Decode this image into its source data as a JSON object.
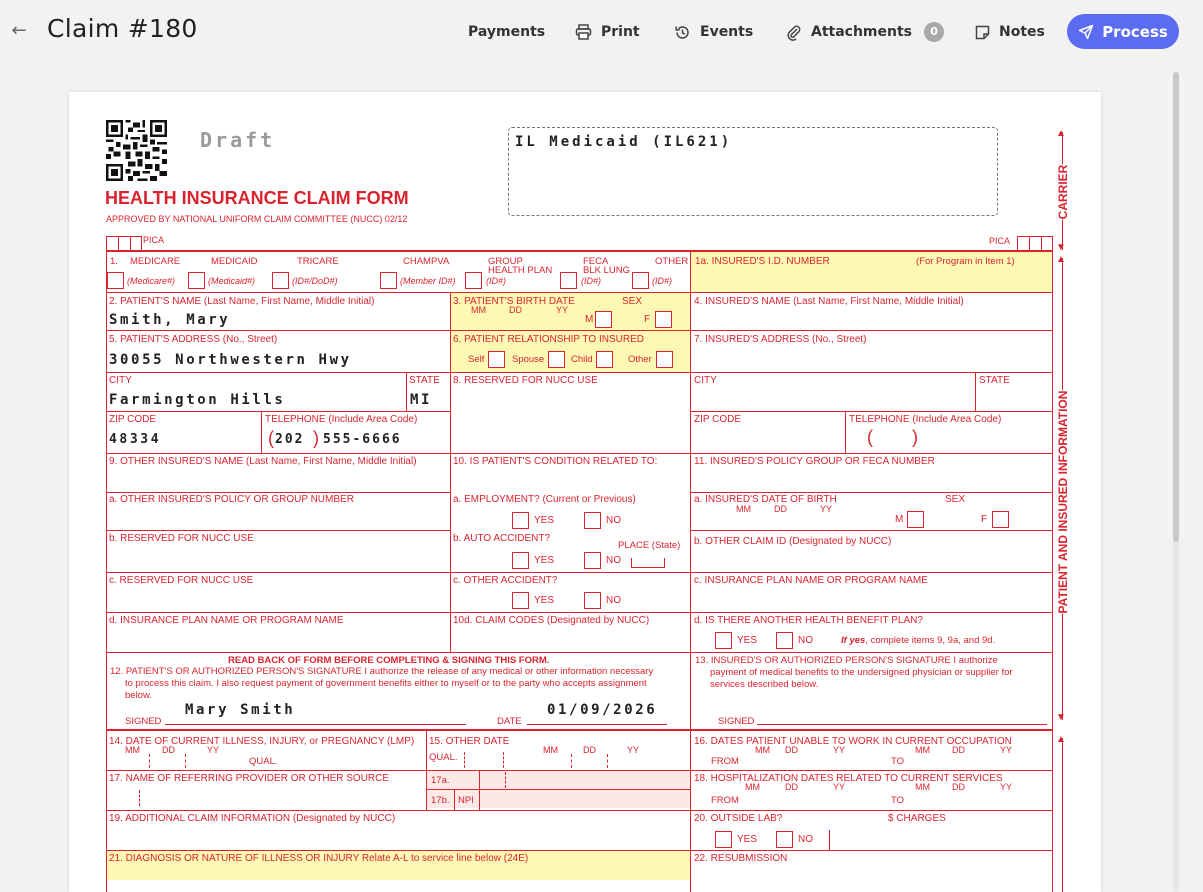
{
  "header": {
    "title": "Claim #180",
    "toolbar": {
      "payments": "Payments",
      "print": "Print",
      "events": "Events",
      "attachments": "Attachments",
      "attachments_count": "0",
      "notes": "Notes",
      "process": "Process"
    },
    "accent": "#5b6cf0"
  },
  "form": {
    "draft": "Draft",
    "payer_box": "IL Medicaid (IL621)",
    "title": "HEALTH INSURANCE CLAIM FORM",
    "approved": "APPROVED BY NATIONAL UNIFORM CLAIM COMMITTEE (NUCC) 02/12",
    "pica": "PICA",
    "carrier": "CARRIER",
    "patient_insured_info": "PATIENT AND INSURED INFORMATION",
    "color": "#d9242f",
    "highlight": "#fdf9b5",
    "f1": {
      "label": "1.",
      "medicare": "MEDICARE",
      "medicare_id": "(Medicare#)",
      "medicaid": "MEDICAID",
      "medicaid_id": "(Medicaid#)",
      "tricare": "TRICARE",
      "tricare_id": "(ID#/DoD#)",
      "champva": "CHAMPVA",
      "champva_id": "(Member ID#)",
      "group": "GROUP",
      "group2": "HEALTH PLAN",
      "group_id": "(ID#)",
      "feca": "FECA",
      "feca2": "BLK LUNG",
      "feca_id": "(ID#)",
      "other": "OTHER",
      "other_id": "(ID#)"
    },
    "f1a": {
      "label": "1a. INSURED'S I.D. NUMBER",
      "note": "(For Program in Item 1)"
    },
    "f2": {
      "label": "2. PATIENT'S NAME (Last Name, First Name, Middle Initial)",
      "value": "Smith, Mary"
    },
    "f3": {
      "label": "3. PATIENT'S BIRTH DATE",
      "sex": "SEX",
      "mm": "MM",
      "dd": "DD",
      "yy": "YY",
      "m": "M",
      "f": "F"
    },
    "f4": {
      "label": "4. INSURED'S NAME (Last Name, First Name, Middle Initial)"
    },
    "f5": {
      "label": "5. PATIENT'S ADDRESS (No., Street)",
      "value": "30055 Northwestern Hwy"
    },
    "f6": {
      "label": "6. PATIENT RELATIONSHIP TO INSURED",
      "self": "Self",
      "spouse": "Spouse",
      "child": "Child",
      "other": "Other"
    },
    "f7": {
      "label": "7. INSURED'S ADDRESS (No., Street)"
    },
    "city": {
      "label": "CITY",
      "value": "Farmington Hills"
    },
    "state": {
      "label": "STATE",
      "value": "MI"
    },
    "f8": {
      "label": "8. RESERVED FOR NUCC USE"
    },
    "city2": {
      "label": "CITY"
    },
    "state2": {
      "label": "STATE"
    },
    "zip": {
      "label": "ZIP CODE",
      "value": "48334"
    },
    "tel": {
      "label": "TELEPHONE (Include Area Code)",
      "area": "202",
      "number": "555-6666"
    },
    "zip2": {
      "label": "ZIP CODE"
    },
    "tel2": {
      "label": "TELEPHONE (Include Area Code)"
    },
    "f9": {
      "label": "9. OTHER INSURED'S NAME (Last Name, First Name, Middle Initial)"
    },
    "f10": {
      "label": "10. IS PATIENT'S CONDITION RELATED TO:"
    },
    "f11": {
      "label": "11. INSURED'S POLICY GROUP OR FECA NUMBER"
    },
    "f9a": {
      "label": "a. OTHER INSURED'S POLICY OR GROUP NUMBER"
    },
    "f10a": {
      "label": "a. EMPLOYMENT? (Current or Previous)"
    },
    "f11a": {
      "label": "a. INSURED'S DATE OF BIRTH",
      "sex": "SEX",
      "mm": "MM",
      "dd": "DD",
      "yy": "YY",
      "m": "M",
      "f": "F"
    },
    "f9b": {
      "label": "b. RESERVED FOR NUCC USE"
    },
    "f10b": {
      "label": "b. AUTO ACCIDENT?",
      "place": "PLACE (State)"
    },
    "f11b": {
      "label": "b. OTHER CLAIM ID (Designated by NUCC)"
    },
    "f9c": {
      "label": "c. RESERVED FOR NUCC USE"
    },
    "f10c": {
      "label": "c. OTHER ACCIDENT?"
    },
    "f11c": {
      "label": "c. INSURANCE PLAN NAME OR PROGRAM NAME"
    },
    "f9d": {
      "label": "d. INSURANCE PLAN NAME OR PROGRAM NAME"
    },
    "f10d": {
      "label": "10d. CLAIM CODES (Designated by NUCC)"
    },
    "f11d": {
      "label": "d. IS THERE ANOTHER HEALTH BENEFIT PLAN?",
      "note_bold": "If yes",
      "note_rest": ", complete items 9, 9a, and 9d."
    },
    "yes": "YES",
    "no": "NO",
    "f12": {
      "readback": "READ BACK OF FORM BEFORE COMPLETING & SIGNING THIS FORM.",
      "line1": "12. PATIENT'S OR AUTHORIZED PERSON'S SIGNATURE  I authorize the release of any medical or other information necessary",
      "line2": "to process this claim. I also request payment of government benefits either to myself or to the party who accepts assignment",
      "line3": "below.",
      "signed": "SIGNED",
      "signature": "Mary Smith",
      "date_label": "DATE",
      "date_value": "01/09/2026"
    },
    "f13": {
      "line1": "13. INSURED'S OR AUTHORIZED PERSON'S SIGNATURE I authorize",
      "line2": "payment of medical benefits to the undersigned physician or supplier for",
      "line3": "services described below.",
      "signed": "SIGNED"
    },
    "f14": {
      "label": "14. DATE OF CURRENT ILLNESS, INJURY, or PREGNANCY (LMP)",
      "mm": "MM",
      "dd": "DD",
      "yy": "YY",
      "qual": "QUAL."
    },
    "f15": {
      "label": "15. OTHER DATE",
      "qual": "QUAL.",
      "mm": "MM",
      "dd": "DD",
      "yy": "YY"
    },
    "f16": {
      "label": "16. DATES PATIENT UNABLE TO WORK IN CURRENT OCCUPATION",
      "mm": "MM",
      "dd": "DD",
      "yy": "YY",
      "from": "FROM",
      "to": "TO"
    },
    "f17": {
      "label": "17. NAME OF REFERRING PROVIDER OR OTHER SOURCE",
      "a": "17a.",
      "b": "17b.",
      "npi": "NPI"
    },
    "f18": {
      "label": "18. HOSPITALIZATION DATES RELATED TO CURRENT SERVICES",
      "mm": "MM",
      "dd": "DD",
      "yy": "YY",
      "from": "FROM",
      "to": "TO"
    },
    "f19": {
      "label": "19. ADDITIONAL CLAIM INFORMATION (Designated by NUCC)"
    },
    "f20": {
      "label": "20. OUTSIDE LAB?",
      "charges": "$ CHARGES"
    },
    "f21": {
      "label": "21. DIAGNOSIS OR NATURE OF ILLNESS OR INJURY  Relate A-L to service line below (24E)"
    },
    "f22": {
      "label": "22. RESUBMISSION"
    }
  }
}
